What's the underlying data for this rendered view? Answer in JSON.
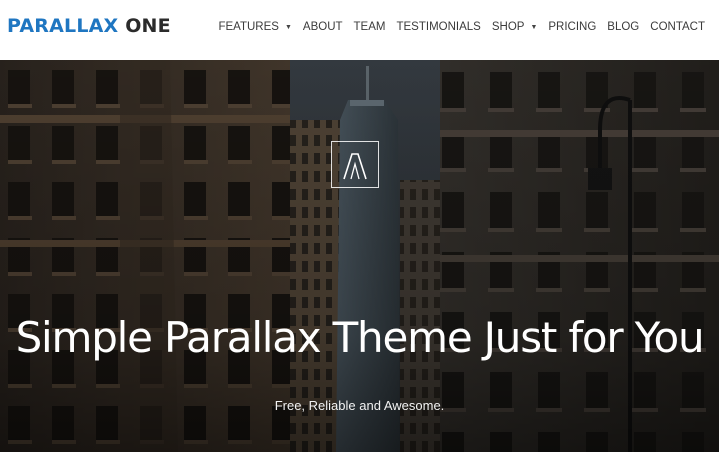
{
  "brand": {
    "part1": "PARALLAX",
    "part2": " ONE"
  },
  "nav": {
    "items": [
      {
        "label": "FEATURES",
        "dropdown": true
      },
      {
        "label": "ABOUT",
        "dropdown": false
      },
      {
        "label": "TEAM",
        "dropdown": false
      },
      {
        "label": "TESTIMONIALS",
        "dropdown": false
      },
      {
        "label": "SHOP",
        "dropdown": true
      },
      {
        "label": "PRICING",
        "dropdown": false
      },
      {
        "label": "BLOG",
        "dropdown": false
      },
      {
        "label": "CONTACT",
        "dropdown": false
      }
    ]
  },
  "hero": {
    "title": "Simple Parallax Theme Just for You",
    "subtitle": "Free, Reliable and Awesome.",
    "mark_icon": "parallax-logo-mark-icon"
  },
  "colors": {
    "brand_blue": "#1f76c1",
    "header_bg": "#ffffff",
    "nav_text": "#3b3b3b",
    "hero_text": "#ffffff"
  }
}
